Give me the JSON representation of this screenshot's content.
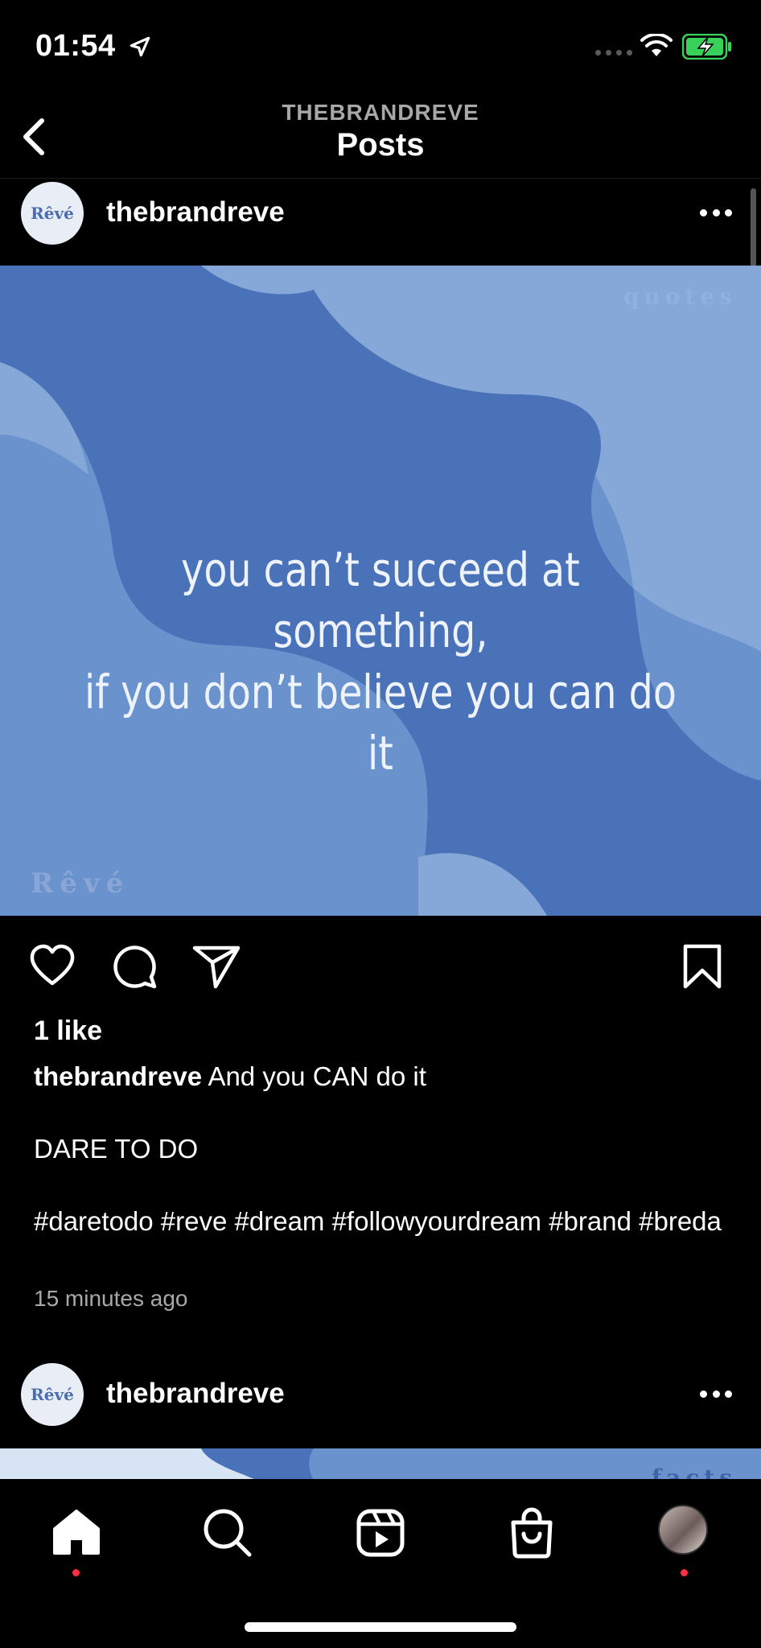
{
  "status_bar": {
    "time": "01:54",
    "icons": [
      "location-arrow-icon",
      "wifi-icon",
      "battery-charging-icon"
    ]
  },
  "header": {
    "subtitle": "THEBRANDREVE",
    "title": "Posts"
  },
  "post1": {
    "avatar_text": "Rêvé",
    "username": "thebrandreve",
    "image": {
      "tag": "quotes",
      "quote_line1": "you can’t succeed at something,",
      "quote_line2": "if you don’t believe you can do it",
      "watermark": "Rêvé",
      "colors": {
        "base": "#4a72b8",
        "light": "#86a8d8",
        "mid": "#6a92cc"
      }
    },
    "likes": "1 like",
    "caption_user": "thebrandreve",
    "caption_text": "And you CAN do it",
    "caption_line2": "DARE TO DO",
    "hashtags": "#daretodo #reve #dream #followyourdream #brand #breda",
    "time_ago": "15 minutes ago"
  },
  "post2": {
    "avatar_text": "Rêvé",
    "username": "thebrandreve",
    "tag": "facts"
  },
  "nav": {
    "items": [
      "home-icon",
      "search-icon",
      "reels-icon",
      "shop-icon",
      "profile-avatar"
    ],
    "active": "home"
  },
  "colors": {
    "notification_dot": "#ff3040",
    "secondary_text": "#a8a8a8"
  }
}
